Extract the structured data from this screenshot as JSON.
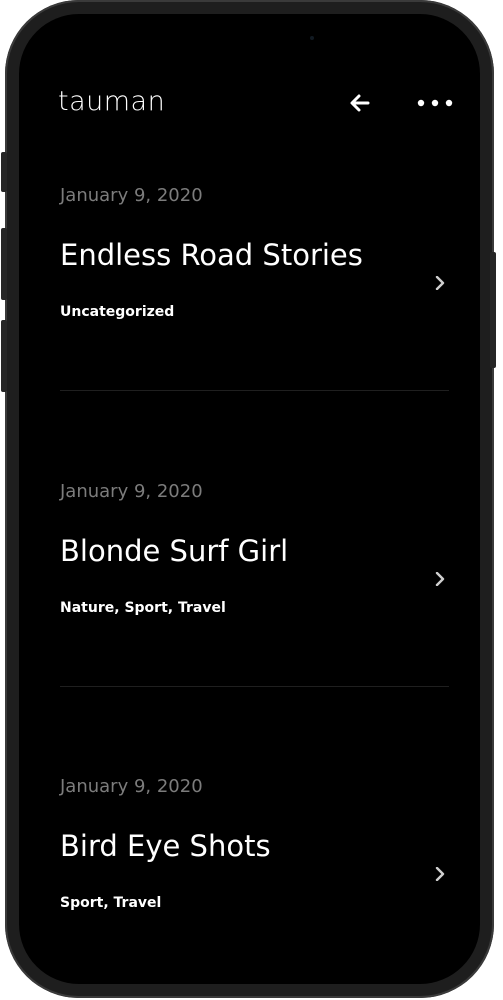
{
  "header": {
    "logo": "tauman"
  },
  "posts": [
    {
      "date": "January 9, 2020",
      "title": "Endless Road Stories",
      "categories": [
        "Uncategorized"
      ]
    },
    {
      "date": "January 9, 2020",
      "title": "Blonde Surf Girl",
      "categories": [
        "Nature",
        "Sport",
        "Travel"
      ]
    },
    {
      "date": "January 9, 2020",
      "title": "Bird Eye Shots",
      "categories": [
        "Sport",
        "Travel"
      ]
    }
  ],
  "icons": {
    "back": "arrow-left-icon",
    "more": "more-dots-icon",
    "chevron": "chevron-right-icon"
  },
  "colors": {
    "background": "#000000",
    "text": "#ffffff",
    "muted": "#7c7c7c",
    "divider": "#1f1f1f"
  }
}
